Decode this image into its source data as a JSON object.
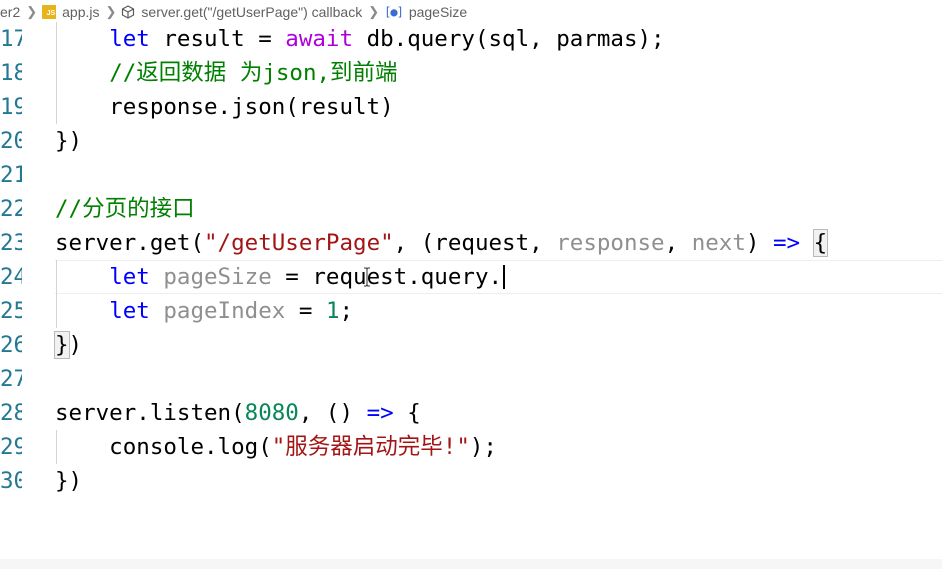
{
  "breadcrumb": {
    "folder": "er2",
    "file": "app.js",
    "function": "server.get(\"/getUserPage\") callback",
    "symbol": "pageSize",
    "icons": [
      "js-file-icon",
      "cube-icon",
      "variable-icon"
    ]
  },
  "editor": {
    "language": "javascript",
    "cursor_line": "24",
    "lines": [
      {
        "num": "17",
        "text": "    let result = await db.query(sql, parmas);"
      },
      {
        "num": "18",
        "text": "    //返回数据 为json,到前端"
      },
      {
        "num": "19",
        "text": "    response.json(result)"
      },
      {
        "num": "20",
        "text": "})"
      },
      {
        "num": "21",
        "text": ""
      },
      {
        "num": "22",
        "text": "//分页的接口"
      },
      {
        "num": "23",
        "text": "server.get(\"/getUserPage\", (request, response, next) => {"
      },
      {
        "num": "24",
        "text": "    let pageSize = request.query."
      },
      {
        "num": "25",
        "text": "    let pageIndex = 1;"
      },
      {
        "num": "26",
        "text": "})"
      },
      {
        "num": "27",
        "text": ""
      },
      {
        "num": "28",
        "text": "server.listen(8080, () => {"
      },
      {
        "num": "29",
        "text": "    console.log(\"服务器启动完毕!\");"
      },
      {
        "num": "30",
        "text": "})"
      }
    ]
  },
  "colors": {
    "keyword": "#0000ff",
    "control_keyword": "#af00db",
    "string": "#a31515",
    "number": "#098658",
    "comment": "#008000",
    "unused_param": "#8f8f8f",
    "line_number": "#237893"
  }
}
